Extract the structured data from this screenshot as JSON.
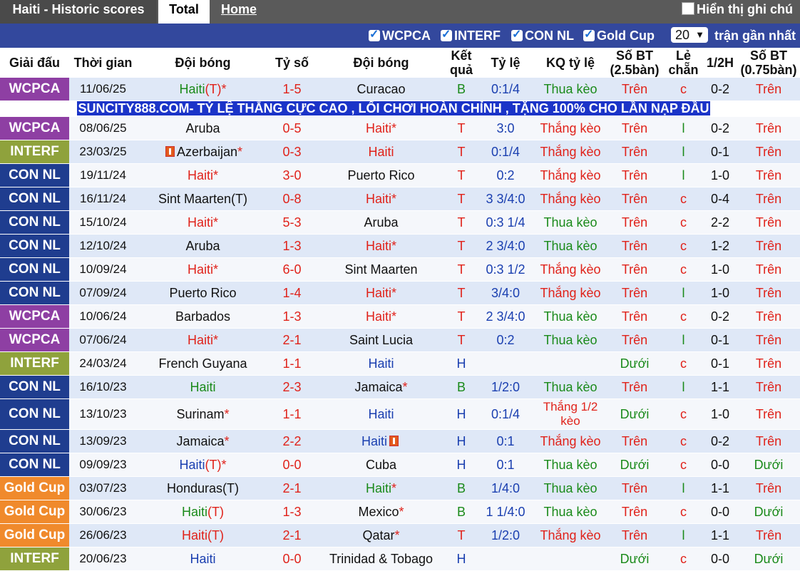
{
  "header": {
    "title_tab": "Haiti - Historic scores",
    "tab_total": "Total",
    "tab_home": "Home",
    "show_notes": "Hiển thị ghi chú"
  },
  "filters": {
    "items": [
      "WCPCA",
      "INTERF",
      "CON NL",
      "Gold Cup"
    ],
    "count_select": "20",
    "recent_label": "trận gần nhất"
  },
  "columns": [
    "Giải đấu",
    "Thời gian",
    "Đội bóng",
    "Tỷ số",
    "Đội bóng",
    "Kết quả",
    "Tỷ lệ",
    "KQ tỷ lệ",
    "Số BT (2.5bàn)",
    "Lẻ chẵn",
    "1/2H",
    "Số BT (0.75bàn)"
  ],
  "ad_text": "SUNCITY888.COM- TỶ LỆ THẮNG CỰC CAO , LỐI CHƠI HOÀN CHỈNH , TẶNG 100% CHO LẦN NẠP ĐẦU",
  "colors": {
    "WCPCA": "#8e3fa3",
    "INTERF": "#8fa23c",
    "CON NL": "#1f3d8f",
    "Gold Cup": "#f08a2c",
    "header_bar": "#5a5a5a",
    "filter_bar": "#33489d"
  },
  "rows": [
    {
      "comp": "WCPCA",
      "date": "11/06/25",
      "home": "Haiti",
      "home_suffix": "(T)*",
      "home_color": "green",
      "hs": "1",
      "as": "5",
      "away": "Curacao",
      "away_suffix": "",
      "away_color": "",
      "res": "B",
      "odds": "0:1/4",
      "oddres": "Thua kèo",
      "ou": "Trên",
      "oe": "c",
      "ht": "0-2",
      "ou2": "Trên"
    },
    {
      "comp": "WCPCA",
      "date": "08/06/25",
      "home": "Aruba",
      "home_suffix": "",
      "home_color": "",
      "hs": "0",
      "as": "5",
      "away": "Haiti",
      "away_suffix": "*",
      "away_color": "red",
      "res": "T",
      "odds": "3:0",
      "oddres": "Thắng kèo",
      "ou": "Trên",
      "oe": "l",
      "ht": "0-2",
      "ou2": "Trên"
    },
    {
      "comp": "INTERF",
      "date": "23/03/25",
      "home": "Azerbaijan",
      "home_suffix": "*",
      "home_color": "",
      "home_flag": true,
      "hs": "0",
      "as": "3",
      "away": "Haiti",
      "away_suffix": "",
      "away_color": "red",
      "res": "T",
      "odds": "0:1/4",
      "oddres": "Thắng kèo",
      "ou": "Trên",
      "oe": "l",
      "ht": "0-1",
      "ou2": "Trên"
    },
    {
      "comp": "CON NL",
      "date": "19/11/24",
      "home": "Haiti",
      "home_suffix": "*",
      "home_color": "red",
      "hs": "3",
      "as": "0",
      "away": "Puerto Rico",
      "away_suffix": "",
      "away_color": "",
      "res": "T",
      "odds": "0:2",
      "oddres": "Thắng kèo",
      "ou": "Trên",
      "oe": "l",
      "ht": "1-0",
      "ou2": "Trên"
    },
    {
      "comp": "CON NL",
      "date": "16/11/24",
      "home": "Sint Maarten(T)",
      "home_suffix": "",
      "home_color": "",
      "hs": "0",
      "as": "8",
      "away": "Haiti",
      "away_suffix": "*",
      "away_color": "red",
      "res": "T",
      "odds": "3 3/4:0",
      "oddres": "Thắng kèo",
      "ou": "Trên",
      "oe": "c",
      "ht": "0-4",
      "ou2": "Trên"
    },
    {
      "comp": "CON NL",
      "date": "15/10/24",
      "home": "Haiti",
      "home_suffix": "*",
      "home_color": "red",
      "hs": "5",
      "as": "3",
      "away": "Aruba",
      "away_suffix": "",
      "away_color": "",
      "res": "T",
      "odds": "0:3 1/4",
      "oddres": "Thua kèo",
      "ou": "Trên",
      "oe": "c",
      "ht": "2-2",
      "ou2": "Trên"
    },
    {
      "comp": "CON NL",
      "date": "12/10/24",
      "home": "Aruba",
      "home_suffix": "",
      "home_color": "",
      "hs": "1",
      "as": "3",
      "away": "Haiti",
      "away_suffix": "*",
      "away_color": "red",
      "res": "T",
      "odds": "2 3/4:0",
      "oddres": "Thua kèo",
      "ou": "Trên",
      "oe": "c",
      "ht": "1-2",
      "ou2": "Trên"
    },
    {
      "comp": "CON NL",
      "date": "10/09/24",
      "home": "Haiti",
      "home_suffix": "*",
      "home_color": "red",
      "hs": "6",
      "as": "0",
      "away": "Sint Maarten",
      "away_suffix": "",
      "away_color": "",
      "res": "T",
      "odds": "0:3 1/2",
      "oddres": "Thắng kèo",
      "ou": "Trên",
      "oe": "c",
      "ht": "1-0",
      "ou2": "Trên"
    },
    {
      "comp": "CON NL",
      "date": "07/09/24",
      "home": "Puerto Rico",
      "home_suffix": "",
      "home_color": "",
      "hs": "1",
      "as": "4",
      "away": "Haiti",
      "away_suffix": "*",
      "away_color": "red",
      "res": "T",
      "odds": "3/4:0",
      "oddres": "Thắng kèo",
      "ou": "Trên",
      "oe": "l",
      "ht": "1-0",
      "ou2": "Trên"
    },
    {
      "comp": "WCPCA",
      "date": "10/06/24",
      "home": "Barbados",
      "home_suffix": "",
      "home_color": "",
      "hs": "1",
      "as": "3",
      "away": "Haiti",
      "away_suffix": "*",
      "away_color": "red",
      "res": "T",
      "odds": "2 3/4:0",
      "oddres": "Thua kèo",
      "ou": "Trên",
      "oe": "c",
      "ht": "0-2",
      "ou2": "Trên"
    },
    {
      "comp": "WCPCA",
      "date": "07/06/24",
      "home": "Haiti",
      "home_suffix": "*",
      "home_color": "red",
      "hs": "2",
      "as": "1",
      "away": "Saint Lucia",
      "away_suffix": "",
      "away_color": "",
      "res": "T",
      "odds": "0:2",
      "oddres": "Thua kèo",
      "ou": "Trên",
      "oe": "l",
      "ht": "0-1",
      "ou2": "Trên"
    },
    {
      "comp": "INTERF",
      "date": "24/03/24",
      "home": "French Guyana",
      "home_suffix": "",
      "home_color": "",
      "hs": "1",
      "as": "1",
      "away": "Haiti",
      "away_suffix": "",
      "away_color": "blue",
      "res": "H",
      "odds": "",
      "oddres": "",
      "ou": "Dưới",
      "oe": "c",
      "ht": "0-1",
      "ou2": "Trên"
    },
    {
      "comp": "CON NL",
      "date": "16/10/23",
      "home": "Haiti",
      "home_suffix": "",
      "home_color": "green",
      "hs": "2",
      "as": "3",
      "away": "Jamaica",
      "away_suffix": "*",
      "away_color": "",
      "res": "B",
      "odds": "1/2:0",
      "oddres": "Thua kèo",
      "ou": "Trên",
      "oe": "l",
      "ht": "1-1",
      "ou2": "Trên"
    },
    {
      "comp": "CON NL",
      "date": "13/10/23",
      "home": "Surinam",
      "home_suffix": "*",
      "home_color": "",
      "hs": "1",
      "as": "1",
      "away": "Haiti",
      "away_suffix": "",
      "away_color": "blue",
      "res": "H",
      "odds": "0:1/4",
      "oddres": "Thắng 1/2 kèo",
      "ou": "Dưới",
      "oe": "c",
      "ht": "1-0",
      "ou2": "Trên"
    },
    {
      "comp": "CON NL",
      "date": "13/09/23",
      "home": "Jamaica",
      "home_suffix": "*",
      "home_color": "",
      "hs": "2",
      "as": "2",
      "away": "Haiti",
      "away_suffix": "",
      "away_color": "blue",
      "away_flag": true,
      "res": "H",
      "odds": "0:1",
      "oddres": "Thắng kèo",
      "ou": "Trên",
      "oe": "c",
      "ht": "0-2",
      "ou2": "Trên"
    },
    {
      "comp": "CON NL",
      "date": "09/09/23",
      "home": "Haiti",
      "home_suffix": "(T)*",
      "home_color": "blue",
      "hs": "0",
      "as": "0",
      "away": "Cuba",
      "away_suffix": "",
      "away_color": "",
      "res": "H",
      "odds": "0:1",
      "oddres": "Thua kèo",
      "ou": "Dưới",
      "oe": "c",
      "ht": "0-0",
      "ou2": "Dưới"
    },
    {
      "comp": "Gold Cup",
      "date": "03/07/23",
      "home": "Honduras(T)",
      "home_suffix": "",
      "home_color": "",
      "hs": "2",
      "as": "1",
      "away": "Haiti",
      "away_suffix": "*",
      "away_color": "green",
      "res": "B",
      "odds": "1/4:0",
      "oddres": "Thua kèo",
      "ou": "Trên",
      "oe": "l",
      "ht": "1-1",
      "ou2": "Trên"
    },
    {
      "comp": "Gold Cup",
      "date": "30/06/23",
      "home": "Haiti",
      "home_suffix": "(T)",
      "home_color": "green",
      "hs": "1",
      "as": "3",
      "away": "Mexico",
      "away_suffix": "*",
      "away_color": "",
      "res": "B",
      "odds": "1 1/4:0",
      "oddres": "Thua kèo",
      "ou": "Trên",
      "oe": "c",
      "ht": "0-0",
      "ou2": "Dưới"
    },
    {
      "comp": "Gold Cup",
      "date": "26/06/23",
      "home": "Haiti",
      "home_suffix": "(T)",
      "home_color": "red",
      "hs": "2",
      "as": "1",
      "away": "Qatar",
      "away_suffix": "*",
      "away_color": "",
      "res": "T",
      "odds": "1/2:0",
      "oddres": "Thắng kèo",
      "ou": "Trên",
      "oe": "l",
      "ht": "1-1",
      "ou2": "Trên"
    },
    {
      "comp": "INTERF",
      "date": "20/06/23",
      "home": "Haiti",
      "home_suffix": "",
      "home_color": "blue",
      "hs": "0",
      "as": "0",
      "away": "Trinidad & Tobago",
      "away_suffix": "",
      "away_color": "",
      "res": "H",
      "odds": "",
      "oddres": "",
      "ou": "Dưới",
      "oe": "c",
      "ht": "0-0",
      "ou2": "Dưới"
    }
  ]
}
